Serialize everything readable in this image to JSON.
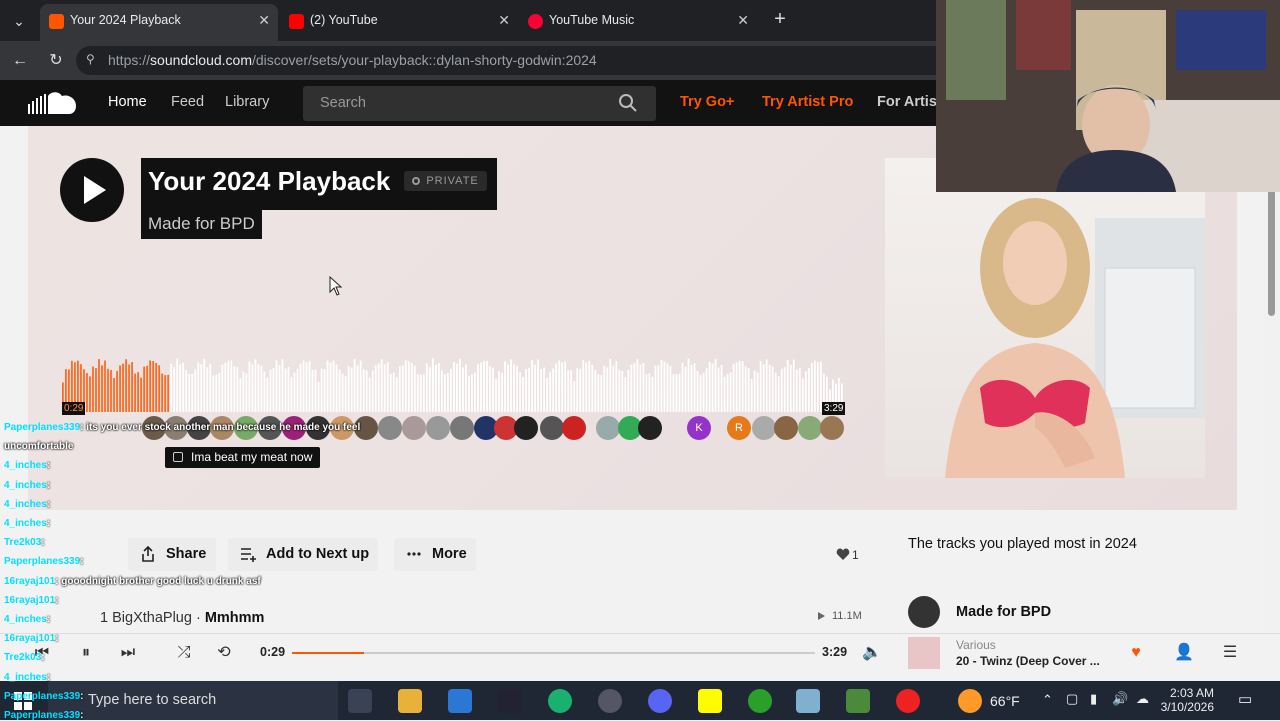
{
  "browser": {
    "tabs": [
      {
        "title": "Your 2024 Playback",
        "favicon_color": "#ff5500",
        "active": true
      },
      {
        "title": "(2) YouTube",
        "favicon_color": "#ff0000",
        "active": false
      },
      {
        "title": "YouTube Music",
        "favicon_color": "#ff0033",
        "active": false
      }
    ],
    "url_prefix": "https://",
    "url_domain": "soundcloud.com",
    "url_path": "/discover/sets/your-playback::dylan-shorty-godwin:2024"
  },
  "sc_header": {
    "nav": [
      "Home",
      "Feed",
      "Library"
    ],
    "search_placeholder": "Search",
    "links": [
      "Try Go+",
      "Try Artist Pro",
      "For Artists"
    ]
  },
  "hero": {
    "title": "Your 2024 Playback",
    "private_label": "PRIVATE",
    "subtitle": "Made for BPD",
    "time_start": "0:29",
    "time_end": "3:29",
    "progress": 0.138,
    "comment": "Ima beat my meat now",
    "avatar_letters": [
      "K",
      "R"
    ]
  },
  "actions": {
    "share": "Share",
    "next_up": "Add to Next up",
    "more": "More",
    "likes": "1"
  },
  "sidebar": {
    "heading": "The tracks you played most in 2024",
    "track_name": "Made for BPD"
  },
  "track": {
    "number": "1",
    "artist": "BigXthaPlug",
    "separator": "·",
    "title": "Mmhmm",
    "plays": "11.1M"
  },
  "player": {
    "elapsed": "0:29",
    "duration": "3:29",
    "progress": 0.138,
    "artist": "Various",
    "title": "20 - Twinz (Deep Cover ..."
  },
  "taskbar": {
    "search_placeholder": "Type here to search",
    "temp": "66°F",
    "time": "2:03 AM",
    "date": "3/10/2026"
  },
  "chat": [
    {
      "user": "Paperplanes339",
      "msg": ": its you ever stock another man because he made you feel"
    },
    {
      "user": "",
      "msg": "uncomfortable"
    },
    {
      "user": "4_inches",
      "msg": ":"
    },
    {
      "user": "4_inches",
      "msg": ":"
    },
    {
      "user": "4_inches",
      "msg": ":"
    },
    {
      "user": "4_inches",
      "msg": ":"
    },
    {
      "user": "Tre2k03",
      "msg": ":"
    },
    {
      "user": "Paperplanes339",
      "msg": ":"
    },
    {
      "user": "16rayaj101",
      "msg": ": gooodnight brother good luck u drunk asf"
    },
    {
      "user": "16rayaj101",
      "msg": ":"
    },
    {
      "user": "4_inches",
      "msg": ":"
    },
    {
      "user": "16rayaj101",
      "msg": ":"
    },
    {
      "user": "Tre2k03",
      "msg": ":"
    },
    {
      "user": "4_inches",
      "msg": ":"
    },
    {
      "user": "Paperplanes339",
      "msg": ":"
    },
    {
      "user": "Paperplanes339",
      "msg": ":"
    }
  ]
}
